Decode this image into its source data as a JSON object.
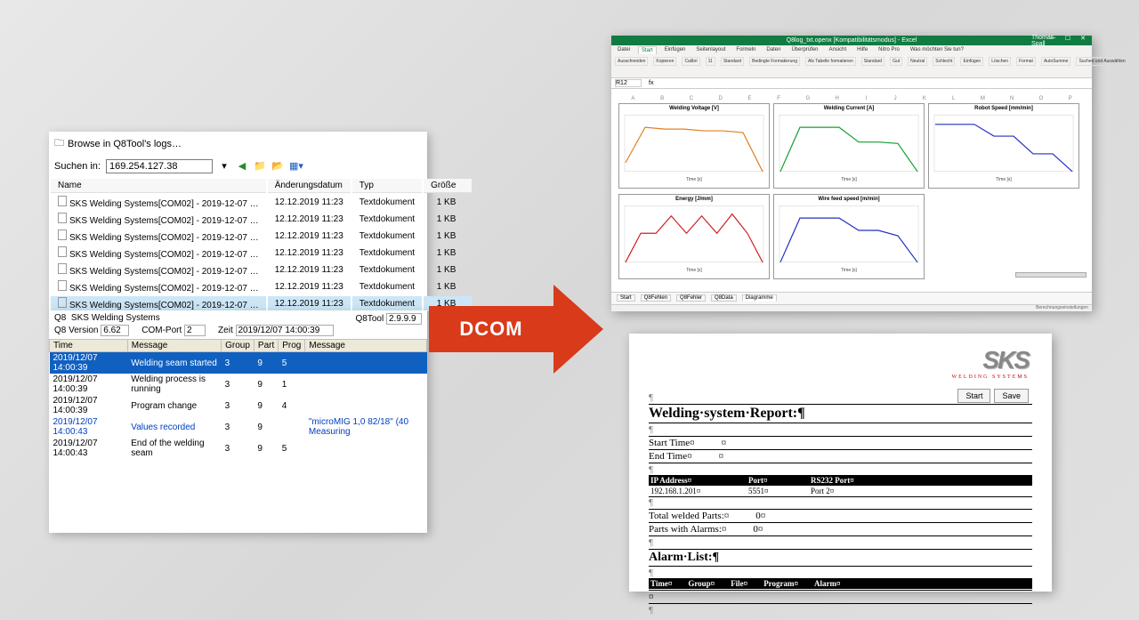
{
  "browse": {
    "title": "Browse in Q8Tool's logs…",
    "search_label": "Suchen in:",
    "search_value": "169.254.127.38",
    "columns": [
      "Name",
      "Änderungsdatum",
      "Typ",
      "Größe"
    ],
    "rows": [
      {
        "name": "SKS Welding Systems[COM02] - 2019-12-07 …",
        "date": "12.12.2019 11:23",
        "type": "Textdokument",
        "size": "1 KB"
      },
      {
        "name": "SKS Welding Systems[COM02] - 2019-12-07 …",
        "date": "12.12.2019 11:23",
        "type": "Textdokument",
        "size": "1 KB"
      },
      {
        "name": "SKS Welding Systems[COM02] - 2019-12-07 …",
        "date": "12.12.2019 11:23",
        "type": "Textdokument",
        "size": "1 KB"
      },
      {
        "name": "SKS Welding Systems[COM02] - 2019-12-07 …",
        "date": "12.12.2019 11:23",
        "type": "Textdokument",
        "size": "1 KB"
      },
      {
        "name": "SKS Welding Systems[COM02] - 2019-12-07 …",
        "date": "12.12.2019 11:23",
        "type": "Textdokument",
        "size": "1 KB"
      },
      {
        "name": "SKS Welding Systems[COM02] - 2019-12-07 …",
        "date": "12.12.2019 11:23",
        "type": "Textdokument",
        "size": "1 KB"
      },
      {
        "name": "SKS Welding Systems[COM02] - 2019-12-07 …",
        "date": "12.12.2019 11:23",
        "type": "Textdokument",
        "size": "1 KB"
      }
    ],
    "selected_index": 6
  },
  "log": {
    "q8_label": "Q8",
    "q8_name": "SKS Welding Systems",
    "q8tool_label": "Q8Tool",
    "q8tool_ver": "2.9.9.9",
    "q8ver_label": "Q8 Version",
    "q8ver": "6.62",
    "com_label": "COM-Port",
    "com": "2",
    "zeit_label": "Zeit",
    "zeit": "2019/12/07 14:00:39",
    "cols": {
      "time": "Time",
      "msg": "Message",
      "group": "Group",
      "part": "Part",
      "prog": "Prog",
      "message": "Message"
    },
    "rows": [
      {
        "time": "2019/12/07 14:00:39",
        "msg": "Welding seam started",
        "group": "3",
        "part": "9",
        "prog": "5",
        "extra": "",
        "cls": "hl"
      },
      {
        "time": "2019/12/07 14:00:39",
        "msg": "Welding process is running",
        "group": "3",
        "part": "9",
        "prog": "1",
        "extra": ""
      },
      {
        "time": "2019/12/07 14:00:39",
        "msg": "Program change",
        "group": "3",
        "part": "9",
        "prog": "4",
        "extra": ""
      },
      {
        "time": "2019/12/07 14:00:43",
        "msg": "Values recorded",
        "group": "3",
        "part": "9",
        "prog": "",
        "extra": "\"microMIG 1,0 82/18\" (40 Measuring",
        "cls": "blue"
      },
      {
        "time": "2019/12/07 14:00:43",
        "msg": "End of the welding seam",
        "group": "3",
        "part": "9",
        "prog": "5",
        "extra": ""
      }
    ]
  },
  "arrow": {
    "label": "DCOM"
  },
  "excel": {
    "title": "Q8log_txt.openx [Kompatibilitätsmodus] - Excel",
    "user": "Thomas Spall",
    "tabs": [
      "Datei",
      "Start",
      "Einfügen",
      "Seitenlayout",
      "Formeln",
      "Daten",
      "Überprüfen",
      "Ansicht",
      "Hilfe",
      "Nitro Pro",
      "Was möchten Sie tun?"
    ],
    "active_tab": 1,
    "ribbon_groups": [
      "Ausschneiden",
      "Kopieren",
      "Calibri",
      "11",
      "Standard",
      "Bedingte Formatierung",
      "Als Tabelle formatieren",
      "Standard",
      "Gut",
      "Neutral",
      "Schlecht",
      "Einfügen",
      "Löschen",
      "Format",
      "AutoSumme",
      "Suchen und Auswählen"
    ],
    "cell_ref": "R12",
    "col_letters": [
      "A",
      "B",
      "C",
      "D",
      "E",
      "F",
      "G",
      "H",
      "I",
      "J",
      "K",
      "L",
      "M",
      "N",
      "O",
      "P"
    ],
    "sheet_tabs": [
      "Start",
      "Q8Fehlen",
      "Q8Fehler",
      "Q8Data",
      "Diagramme"
    ],
    "active_sheet": 4,
    "status_right": "Berechnungseinstellungen"
  },
  "report": {
    "logo": "SKS",
    "logo_sub": "WELDING SYSTEMS",
    "btn_start": "Start",
    "btn_save": "Save",
    "heading": "Welding·system·Report:¶",
    "start_label": "Start Time¤",
    "start_val": "¤",
    "end_label": "End Time¤",
    "end_val": "¤",
    "hdr_ip": "IP Address¤",
    "hdr_port": "Port¤",
    "hdr_rs": "RS232 Port¤",
    "ip": "192.168.1.201¤",
    "port": "5551¤",
    "rs": "Port 2¤",
    "total_label": "Total welded Parts:¤",
    "total_val": "0¤",
    "alarm_parts_label": "Parts with Alarms:¤",
    "alarm_parts_val": "0¤",
    "alarm_heading": "Alarm·List:¶",
    "al_cols": {
      "time": "Time¤",
      "group": "Group¤",
      "file": "File¤",
      "prog": "Program¤",
      "alarm": "Alarm¤"
    },
    "al_row": "¤"
  },
  "chart_data": [
    {
      "type": "line",
      "title": "Welding Voltage [V]",
      "xlabel": "Time [s]",
      "color": "#e08020",
      "x": [
        0,
        5,
        10,
        15,
        20,
        25,
        30
      ],
      "values": [
        5,
        25,
        24,
        24,
        23,
        23,
        22,
        0
      ],
      "ylim": [
        0,
        30
      ]
    },
    {
      "type": "line",
      "title": "Welding Current [A]",
      "xlabel": "Time [s]",
      "color": "#10a030",
      "x": [
        0,
        5,
        10,
        15,
        20,
        25,
        30
      ],
      "values": [
        0,
        150,
        150,
        150,
        100,
        100,
        95,
        0
      ],
      "ylim": [
        0,
        180
      ]
    },
    {
      "type": "line",
      "title": "Robot Speed [mm/min]",
      "xlabel": "Time [s]",
      "color": "#2030c0",
      "x": [
        0,
        5,
        10,
        15,
        20,
        25,
        30
      ],
      "values": [
        0.8,
        0.8,
        0.8,
        0.6,
        0.6,
        0.3,
        0.3,
        0
      ],
      "ylim": [
        0,
        0.9
      ]
    },
    {
      "type": "line",
      "title": "Energy [J/mm]",
      "xlabel": "Time [s]",
      "color": "#d02020",
      "x": [
        0,
        5,
        10,
        15,
        20,
        25,
        30
      ],
      "values": [
        0,
        300,
        300,
        480,
        300,
        480,
        300,
        500,
        300,
        0
      ],
      "ylim": [
        0,
        550
      ]
    },
    {
      "type": "line",
      "title": "Wire feed speed [m/min]",
      "xlabel": "Time [s]",
      "color": "#2030c0",
      "x": [
        0,
        5,
        10,
        15,
        20,
        25,
        30
      ],
      "values": [
        0,
        25,
        25,
        25,
        18,
        18,
        15,
        0
      ],
      "ylim": [
        0,
        30
      ]
    }
  ]
}
